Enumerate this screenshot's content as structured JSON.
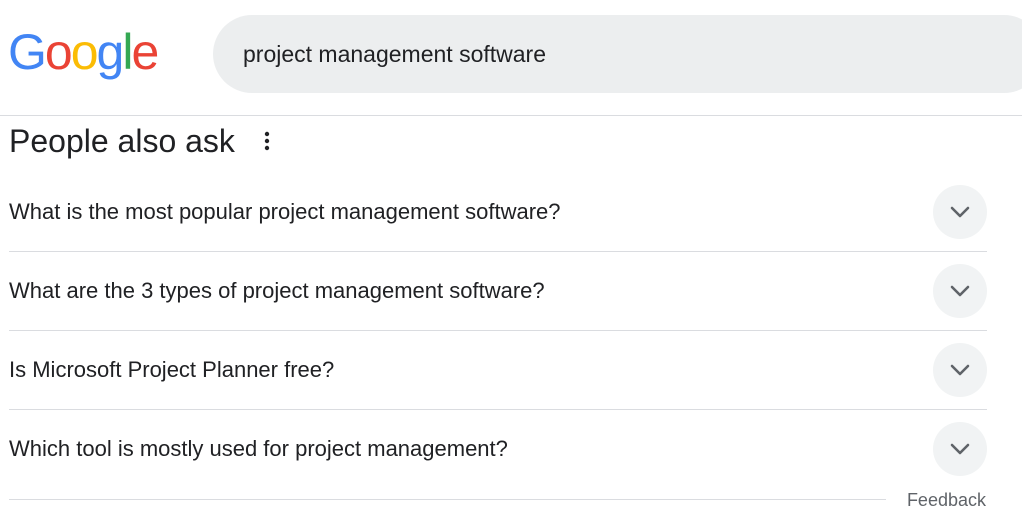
{
  "header": {
    "logo": {
      "letters": [
        "G",
        "o",
        "o",
        "g",
        "l",
        "e"
      ],
      "colors": [
        "#4285F4",
        "#EA4335",
        "#FBBC05",
        "#4285F4",
        "#34A853",
        "#EA4335"
      ]
    },
    "search": {
      "value": "project management software"
    }
  },
  "people_also_ask": {
    "title": "People also ask",
    "menu_icon": "more-vert-icon",
    "questions": [
      {
        "text": "What is the most popular project management software?",
        "icon": "chevron-down-icon"
      },
      {
        "text": "What are the 3 types of project management software?",
        "icon": "chevron-down-icon"
      },
      {
        "text": "Is Microsoft Project Planner free?",
        "icon": "chevron-down-icon"
      },
      {
        "text": "Which tool is mostly used for project management?",
        "icon": "chevron-down-icon"
      }
    ]
  },
  "footer": {
    "feedback_label": "Feedback"
  },
  "colors": {
    "search_bg": "#eceeef",
    "divider": "#dadce0",
    "chevron_bg": "#f1f3f4",
    "text": "#202124",
    "secondary_text": "#5f6368"
  }
}
